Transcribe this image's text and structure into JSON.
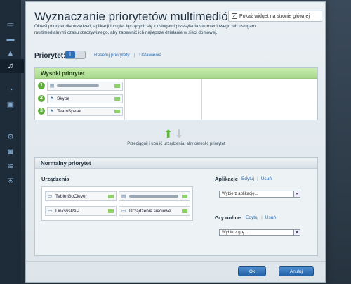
{
  "sidebar": {
    "icons": [
      "network-icon",
      "devices-icon",
      "warning-icon",
      "media-priority-icon",
      "security-icon",
      "speed-icon",
      "settings-icon",
      "camera-icon",
      "wifi-icon",
      "shield-icon"
    ]
  },
  "dialog": {
    "title": "Wyznaczanie priorytetów multimediów",
    "widget_checkbox_label": "Pokaż widget na stronie głównej",
    "widget_checked": "✓",
    "description": "Określ priorytet dla urządzeń, aplikacji lub gier łączących się z usługami przesyłania strumieniowego lub usługami multimedialnymi czasu rzeczywistego, aby zapewnić ich najlepsze działanie w sieci domowej."
  },
  "priority": {
    "label": "Priorytet:",
    "toggle_state": "I",
    "reset_link": "Resetuj priorytety",
    "separator": "|",
    "settings_link": "Ustawienia"
  },
  "high_priority": {
    "title": "Wysoki priorytet",
    "items": [
      {
        "number": "1",
        "name": ""
      },
      {
        "number": "2",
        "name": "Skype"
      },
      {
        "number": "3",
        "name": "TeamSpeak"
      }
    ]
  },
  "drag_hint": "Przeciągnij i upuść urządzenia, aby określić priorytet",
  "normal_priority": {
    "title": "Normalny priorytet",
    "devices_label": "Urządzenia",
    "devices": [
      {
        "name": "TabletGoClever"
      },
      {
        "name": ""
      },
      {
        "name": "LinksysPAP"
      },
      {
        "name": "Urządzenie sieciowe"
      }
    ],
    "apps_label": "Aplikacje",
    "apps_edit": "Edytuj",
    "apps_separator": "|",
    "apps_delete": "Usuń",
    "apps_select": "Wybierz aplikację...",
    "games_label": "Gry online",
    "games_edit": "Edytuj",
    "games_separator": "|",
    "games_delete": "Usuń",
    "games_select": "Wybierz grę..."
  },
  "buttons": {
    "ok": "Ok",
    "cancel": "Anuluj"
  }
}
